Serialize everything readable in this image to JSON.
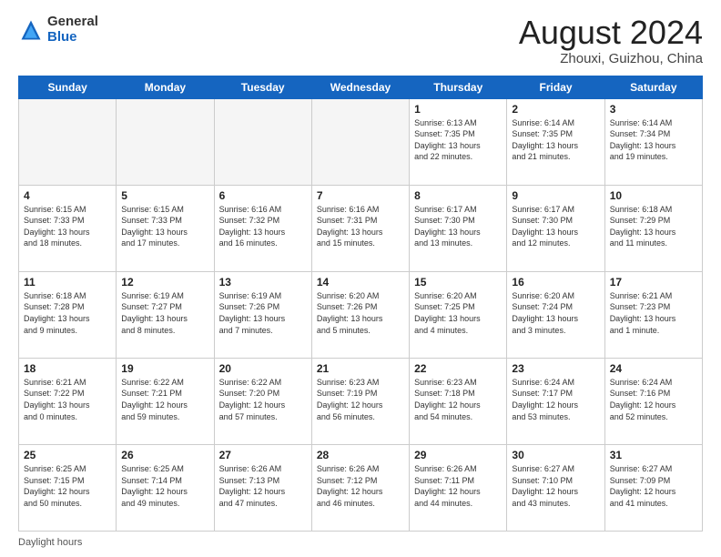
{
  "header": {
    "logo_general": "General",
    "logo_blue": "Blue",
    "main_title": "August 2024",
    "subtitle": "Zhouxi, Guizhou, China"
  },
  "calendar": {
    "days_of_week": [
      "Sunday",
      "Monday",
      "Tuesday",
      "Wednesday",
      "Thursday",
      "Friday",
      "Saturday"
    ],
    "weeks": [
      [
        {
          "day": "",
          "info": ""
        },
        {
          "day": "",
          "info": ""
        },
        {
          "day": "",
          "info": ""
        },
        {
          "day": "",
          "info": ""
        },
        {
          "day": "1",
          "info": "Sunrise: 6:13 AM\nSunset: 7:35 PM\nDaylight: 13 hours\nand 22 minutes."
        },
        {
          "day": "2",
          "info": "Sunrise: 6:14 AM\nSunset: 7:35 PM\nDaylight: 13 hours\nand 21 minutes."
        },
        {
          "day": "3",
          "info": "Sunrise: 6:14 AM\nSunset: 7:34 PM\nDaylight: 13 hours\nand 19 minutes."
        }
      ],
      [
        {
          "day": "4",
          "info": "Sunrise: 6:15 AM\nSunset: 7:33 PM\nDaylight: 13 hours\nand 18 minutes."
        },
        {
          "day": "5",
          "info": "Sunrise: 6:15 AM\nSunset: 7:33 PM\nDaylight: 13 hours\nand 17 minutes."
        },
        {
          "day": "6",
          "info": "Sunrise: 6:16 AM\nSunset: 7:32 PM\nDaylight: 13 hours\nand 16 minutes."
        },
        {
          "day": "7",
          "info": "Sunrise: 6:16 AM\nSunset: 7:31 PM\nDaylight: 13 hours\nand 15 minutes."
        },
        {
          "day": "8",
          "info": "Sunrise: 6:17 AM\nSunset: 7:30 PM\nDaylight: 13 hours\nand 13 minutes."
        },
        {
          "day": "9",
          "info": "Sunrise: 6:17 AM\nSunset: 7:30 PM\nDaylight: 13 hours\nand 12 minutes."
        },
        {
          "day": "10",
          "info": "Sunrise: 6:18 AM\nSunset: 7:29 PM\nDaylight: 13 hours\nand 11 minutes."
        }
      ],
      [
        {
          "day": "11",
          "info": "Sunrise: 6:18 AM\nSunset: 7:28 PM\nDaylight: 13 hours\nand 9 minutes."
        },
        {
          "day": "12",
          "info": "Sunrise: 6:19 AM\nSunset: 7:27 PM\nDaylight: 13 hours\nand 8 minutes."
        },
        {
          "day": "13",
          "info": "Sunrise: 6:19 AM\nSunset: 7:26 PM\nDaylight: 13 hours\nand 7 minutes."
        },
        {
          "day": "14",
          "info": "Sunrise: 6:20 AM\nSunset: 7:26 PM\nDaylight: 13 hours\nand 5 minutes."
        },
        {
          "day": "15",
          "info": "Sunrise: 6:20 AM\nSunset: 7:25 PM\nDaylight: 13 hours\nand 4 minutes."
        },
        {
          "day": "16",
          "info": "Sunrise: 6:20 AM\nSunset: 7:24 PM\nDaylight: 13 hours\nand 3 minutes."
        },
        {
          "day": "17",
          "info": "Sunrise: 6:21 AM\nSunset: 7:23 PM\nDaylight: 13 hours\nand 1 minute."
        }
      ],
      [
        {
          "day": "18",
          "info": "Sunrise: 6:21 AM\nSunset: 7:22 PM\nDaylight: 13 hours\nand 0 minutes."
        },
        {
          "day": "19",
          "info": "Sunrise: 6:22 AM\nSunset: 7:21 PM\nDaylight: 12 hours\nand 59 minutes."
        },
        {
          "day": "20",
          "info": "Sunrise: 6:22 AM\nSunset: 7:20 PM\nDaylight: 12 hours\nand 57 minutes."
        },
        {
          "day": "21",
          "info": "Sunrise: 6:23 AM\nSunset: 7:19 PM\nDaylight: 12 hours\nand 56 minutes."
        },
        {
          "day": "22",
          "info": "Sunrise: 6:23 AM\nSunset: 7:18 PM\nDaylight: 12 hours\nand 54 minutes."
        },
        {
          "day": "23",
          "info": "Sunrise: 6:24 AM\nSunset: 7:17 PM\nDaylight: 12 hours\nand 53 minutes."
        },
        {
          "day": "24",
          "info": "Sunrise: 6:24 AM\nSunset: 7:16 PM\nDaylight: 12 hours\nand 52 minutes."
        }
      ],
      [
        {
          "day": "25",
          "info": "Sunrise: 6:25 AM\nSunset: 7:15 PM\nDaylight: 12 hours\nand 50 minutes."
        },
        {
          "day": "26",
          "info": "Sunrise: 6:25 AM\nSunset: 7:14 PM\nDaylight: 12 hours\nand 49 minutes."
        },
        {
          "day": "27",
          "info": "Sunrise: 6:26 AM\nSunset: 7:13 PM\nDaylight: 12 hours\nand 47 minutes."
        },
        {
          "day": "28",
          "info": "Sunrise: 6:26 AM\nSunset: 7:12 PM\nDaylight: 12 hours\nand 46 minutes."
        },
        {
          "day": "29",
          "info": "Sunrise: 6:26 AM\nSunset: 7:11 PM\nDaylight: 12 hours\nand 44 minutes."
        },
        {
          "day": "30",
          "info": "Sunrise: 6:27 AM\nSunset: 7:10 PM\nDaylight: 12 hours\nand 43 minutes."
        },
        {
          "day": "31",
          "info": "Sunrise: 6:27 AM\nSunset: 7:09 PM\nDaylight: 12 hours\nand 41 minutes."
        }
      ]
    ]
  },
  "footer": {
    "text": "Daylight hours"
  }
}
